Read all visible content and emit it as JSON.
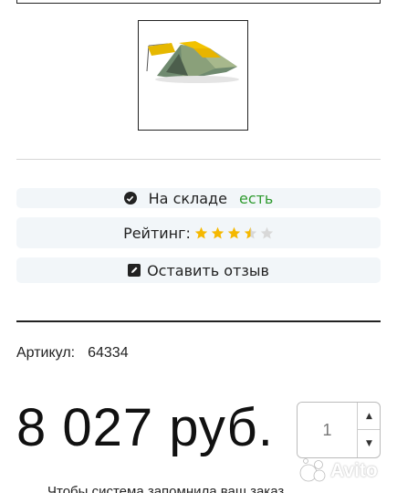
{
  "stock": {
    "label": "На складе",
    "value": "есть",
    "value_color": "#2e9a2e"
  },
  "rating": {
    "label": "Рейтинг:",
    "value": 3.5,
    "max": 5,
    "star_color": "#f5b800",
    "empty_color": "#d8d8d8"
  },
  "review": {
    "label": "Оставить отзыв"
  },
  "product": {
    "sku_label": "Артикул:",
    "sku_value": "64334",
    "price": "8 027 руб."
  },
  "quantity": {
    "value": "1"
  },
  "footer": {
    "text": "Чтобы система запомнила ваш заказ"
  },
  "watermark": {
    "text": "Avito"
  }
}
